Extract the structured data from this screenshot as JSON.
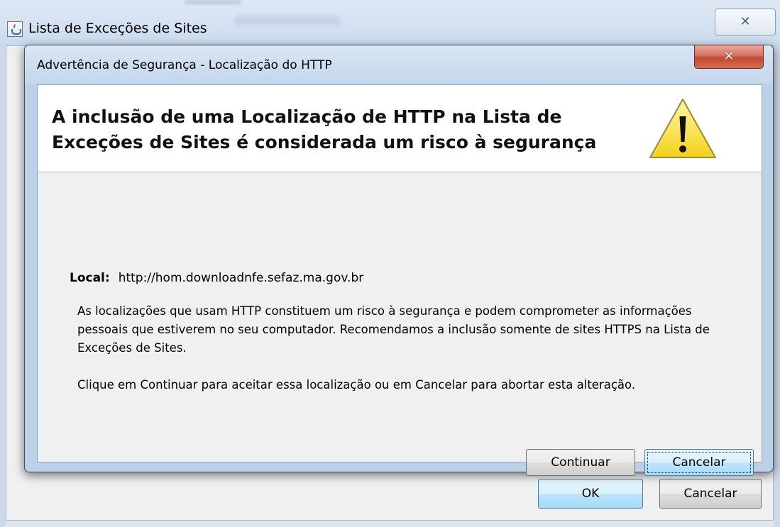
{
  "parent_window": {
    "title": "Lista de Exceções de Sites",
    "close_glyph": "✕",
    "ok_label": "OK",
    "cancel_label": "Cancelar"
  },
  "dialog": {
    "title": "Advertência de Segurança - Localização do HTTP",
    "close_glyph": "✕",
    "headline": "A inclusão de uma Localização de HTTP na Lista de Exceções de Sites é considerada um risco à segurança",
    "warning_icon": "warning-triangle-icon",
    "local_label": "Local:",
    "local_value": "http://hom.downloadnfe.sefaz.ma.gov.br",
    "paragraph_1": "As localizações que usam HTTP constituem um risco à segurança e podem comprometer as informações pessoais que estiverem no seu computador. Recomendamos a inclusão somente de sites HTTPS na Lista de Exceções de Sites.",
    "paragraph_2": "Clique em Continuar para aceitar essa localização ou em Cancelar para abortar esta alteração.",
    "continue_label": "Continuar",
    "cancel_label": "Cancelar"
  },
  "colors": {
    "close_button_red": "#c24a32",
    "default_button_blue": "#a7d9f5",
    "warning_yellow": "#f7e03c"
  }
}
